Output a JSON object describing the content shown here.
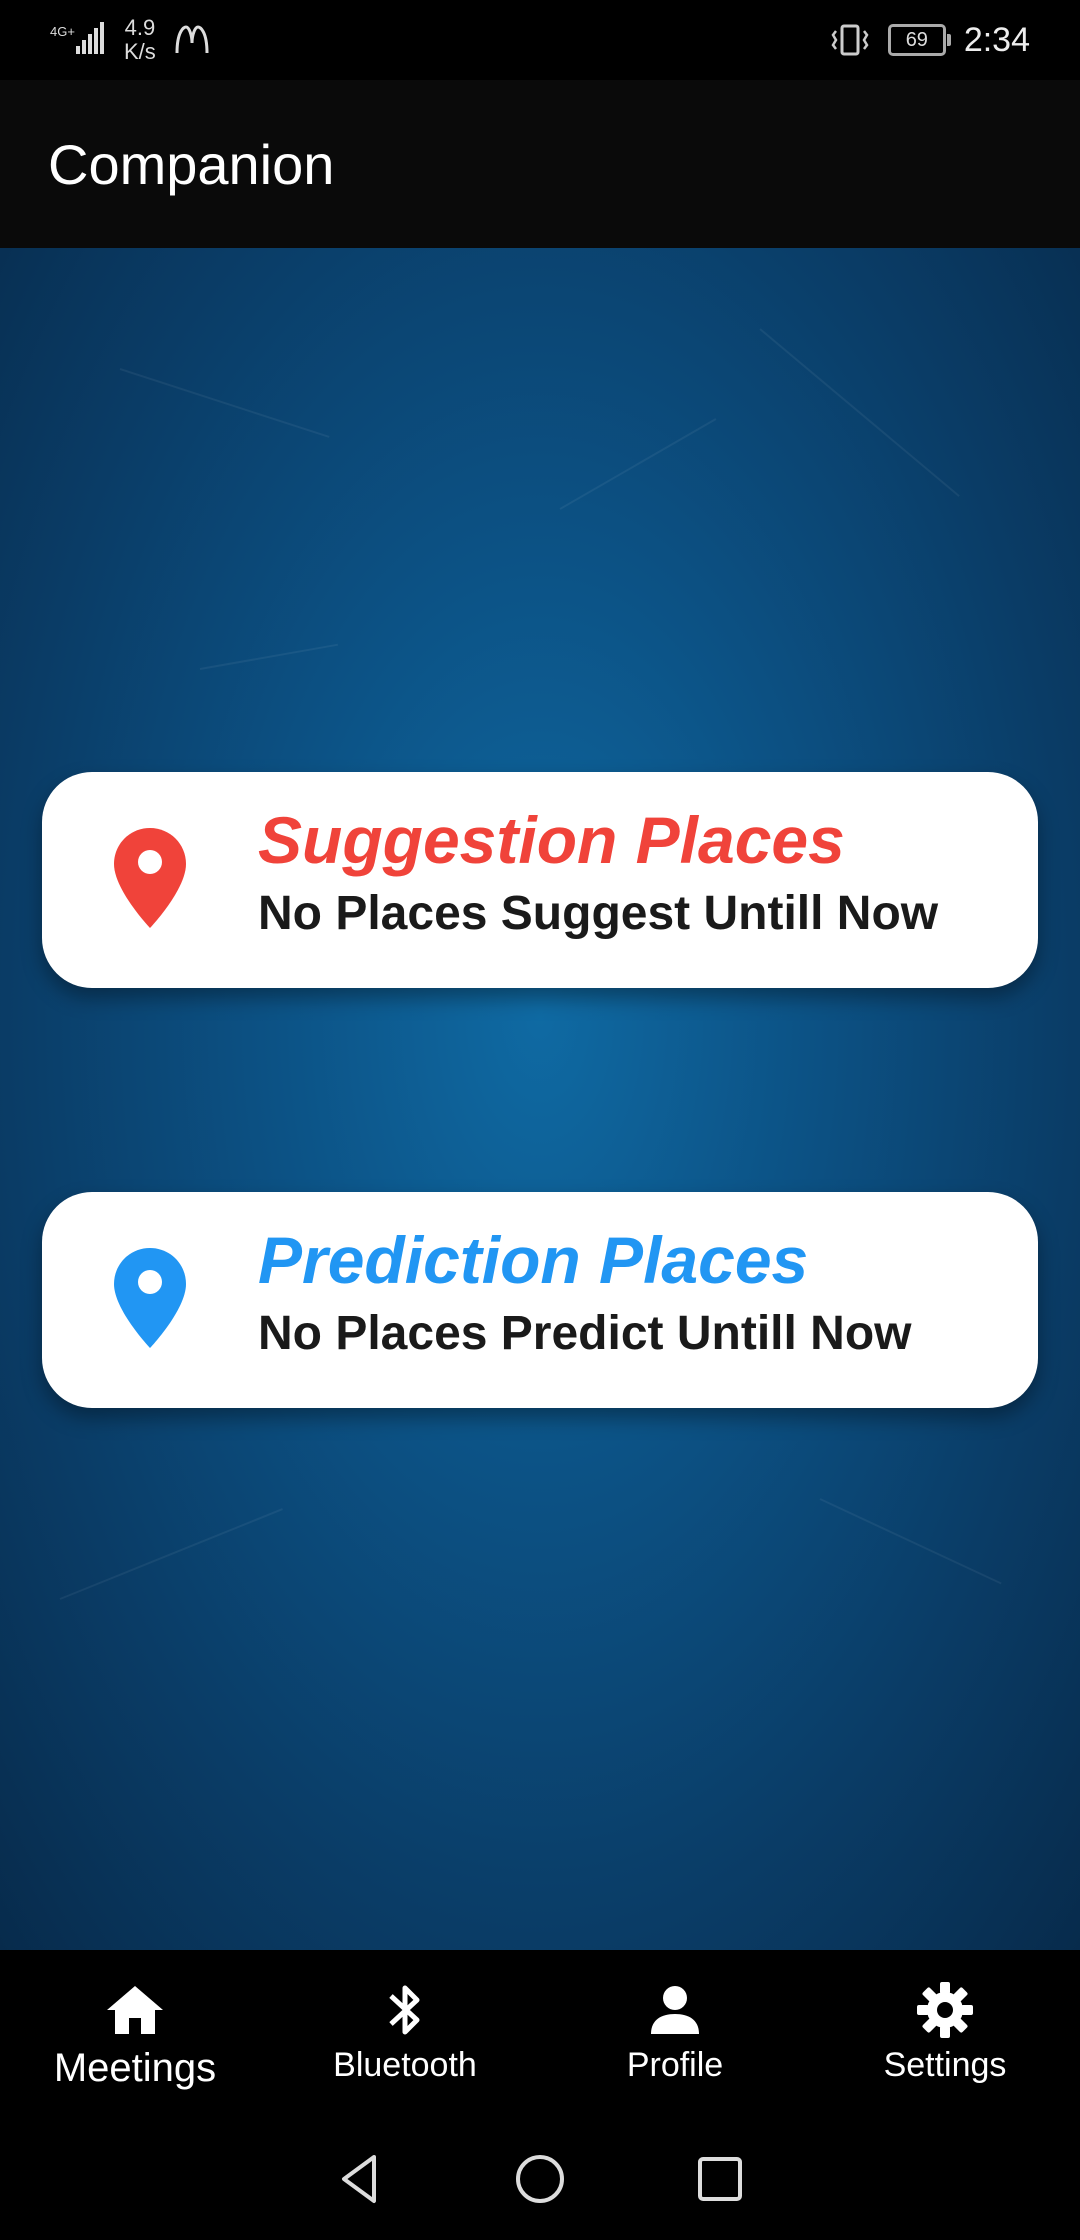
{
  "status_bar": {
    "network": "4G+",
    "speed_value": "4.9",
    "speed_unit": "K/s",
    "battery": "69",
    "time": "2:34"
  },
  "app_bar": {
    "title": "Companion"
  },
  "cards": [
    {
      "title": "Suggestion Places",
      "subtitle": "No Places Suggest Untill Now",
      "accent": "#f0433a",
      "icon": "location-pin-icon"
    },
    {
      "title": "Prediction Places",
      "subtitle": "No Places Predict Untill Now",
      "accent": "#2196f3",
      "icon": "location-pin-icon"
    }
  ],
  "bottom_nav": {
    "items": [
      {
        "label": "Meetings",
        "icon": "home-icon",
        "active": true
      },
      {
        "label": "Bluetooth",
        "icon": "bluetooth-icon",
        "active": false
      },
      {
        "label": "Profile",
        "icon": "person-icon",
        "active": false
      },
      {
        "label": "Settings",
        "icon": "gear-icon",
        "active": false
      }
    ]
  },
  "colors": {
    "background_blue": "#0c5285",
    "app_bar": "#0a0a0a",
    "text_dark": "#1a1a1a"
  }
}
